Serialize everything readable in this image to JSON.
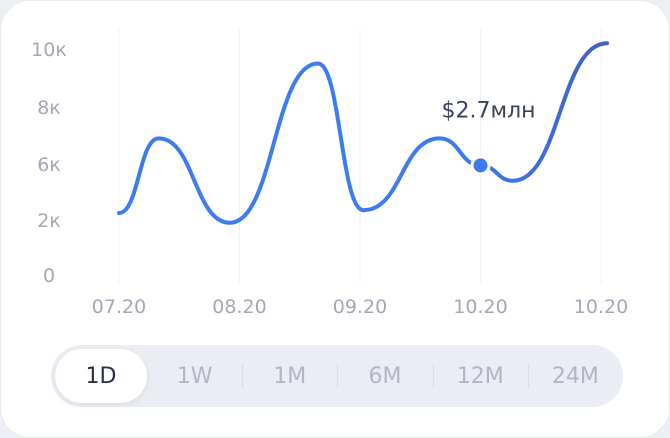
{
  "chart_data": {
    "type": "line",
    "y_tick_labels": [
      "10к",
      "8к",
      "6к",
      "2к",
      "0"
    ],
    "x_tick_labels": [
      "07.20",
      "08.20",
      "09.20",
      "10.20",
      "10.20"
    ],
    "grid": "vertical",
    "series": [
      {
        "points": [
          {
            "x": 0.0,
            "y": 2.5
          },
          {
            "x": 0.33,
            "y": 6.9
          },
          {
            "x": 0.92,
            "y": 1.9
          },
          {
            "x": 1.65,
            "y": 9.5
          },
          {
            "x": 2.03,
            "y": 2.7
          },
          {
            "x": 2.66,
            "y": 6.9
          },
          {
            "x": 3.0,
            "y": 5.9
          },
          {
            "x": 3.27,
            "y": 4.8
          },
          {
            "x": 4.05,
            "y": 10.2
          }
        ]
      }
    ],
    "highlight": {
      "x": 3.0,
      "y": 5.9,
      "label": "$2.7млн"
    },
    "colors": {
      "line": "#3d7cf0",
      "line_end": "#3f5fc8",
      "marker": "#3d79f0"
    }
  },
  "range_tabs": {
    "items": [
      "1D",
      "1W",
      "1M",
      "6M",
      "12M",
      "24M"
    ],
    "selected": "1D"
  }
}
